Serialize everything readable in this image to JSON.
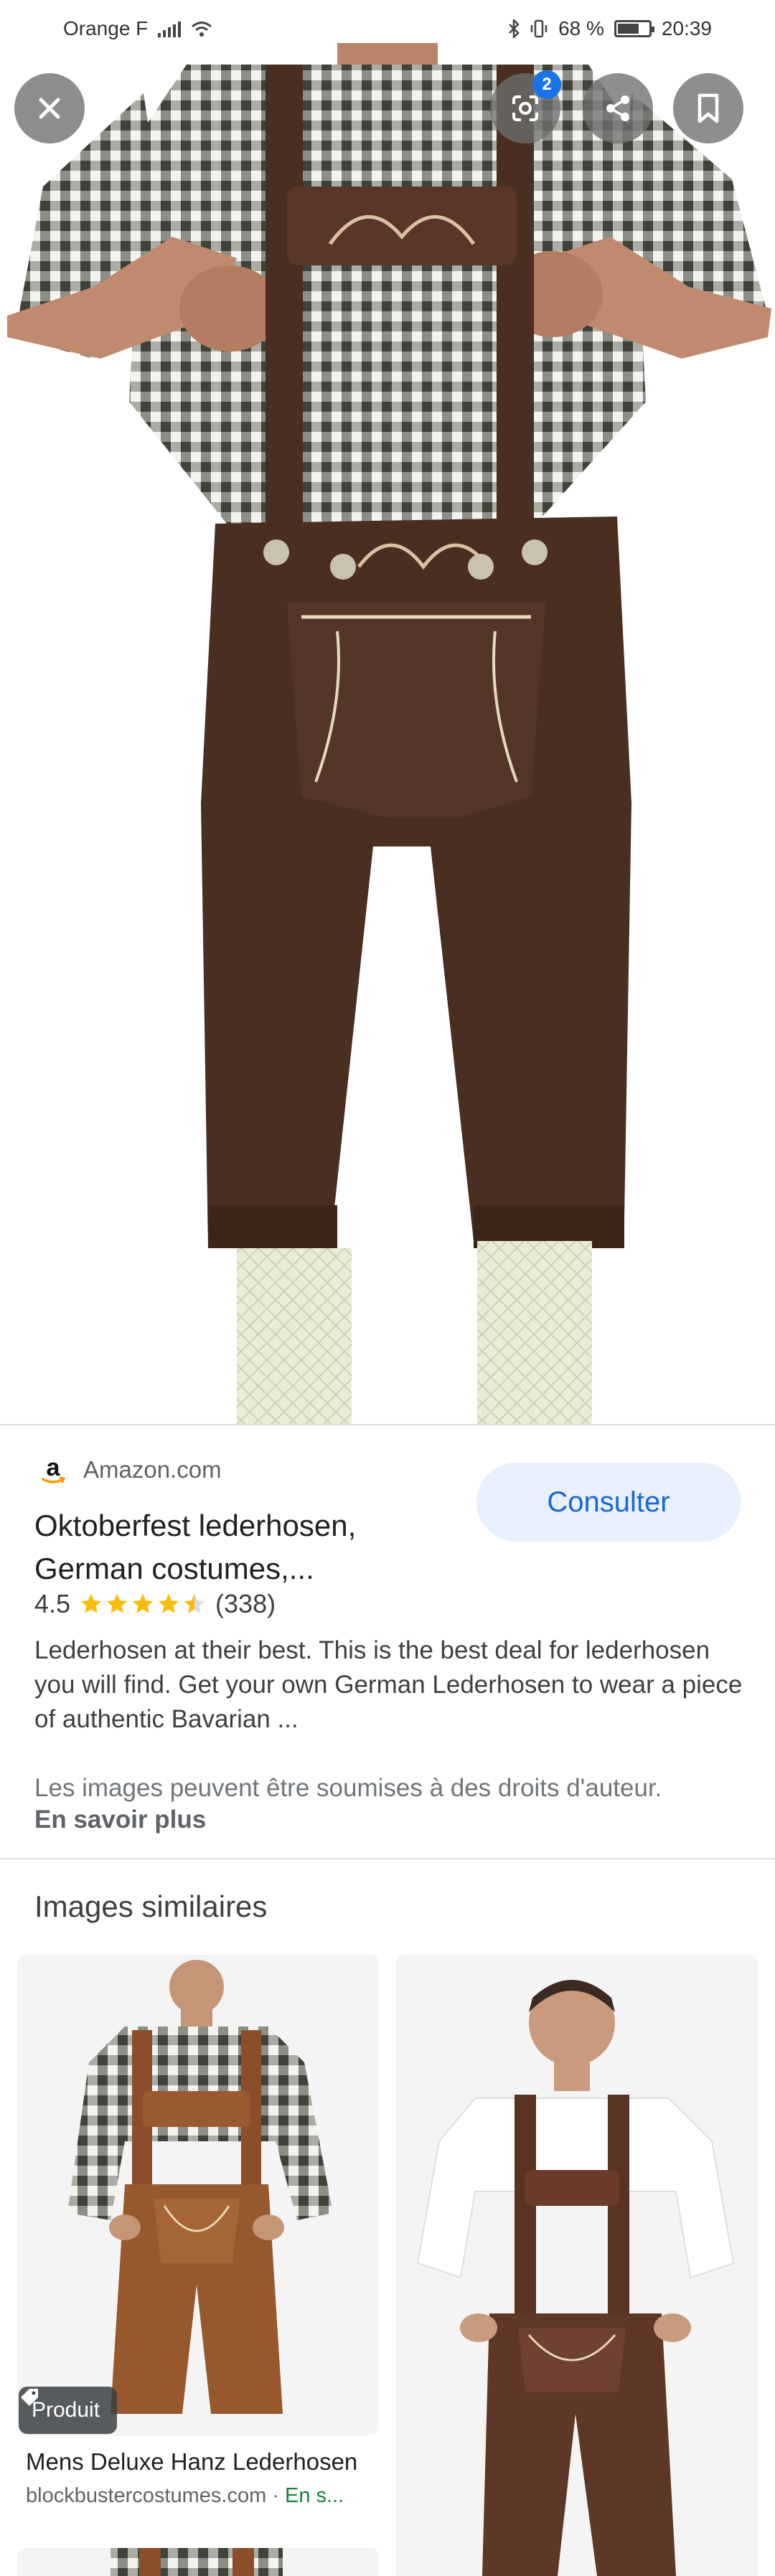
{
  "status_bar": {
    "carrier": "Orange F",
    "battery_percent": "68 %",
    "battery_level": 0.68,
    "time": "20:39"
  },
  "viewer": {
    "close_icon": "close-icon",
    "lens_icon": "google-lens-icon",
    "lens_badge": "2",
    "share_icon": "share-icon",
    "save_icon": "bookmark-icon"
  },
  "result": {
    "source": "Amazon.com",
    "source_icon": "amazon-logo",
    "visit_button": "Consulter",
    "title_line1": "Oktoberfest lederhosen,",
    "title_line2": "German costumes,...",
    "rating": "4.5",
    "rating_value": 4.5,
    "review_count": "(338)",
    "description": "Lederhosen at their best. This is the best deal for lederhosen you will find. Get your own German Lederhosen to wear a piece of authentic Bavarian ...",
    "copyright_notice": "Les images peuvent être soumises à des droits d'auteur.",
    "learn_more": "En savoir plus"
  },
  "similar": {
    "heading": "Images similaires",
    "items": [
      {
        "chip_label": "Produit",
        "chip_icon": "tag-icon",
        "title": "Mens Deluxe Hanz Lederhosen",
        "source": "blockbustercostumes.com · ",
        "stock": "En s..."
      },
      {
        "title": "",
        "source": ""
      }
    ]
  },
  "colors": {
    "accent": "#1a73e8",
    "button_bg": "#e8f0fe",
    "star": "#fbbc04",
    "in_stock": "#188038",
    "leather": "#4a2e22"
  }
}
